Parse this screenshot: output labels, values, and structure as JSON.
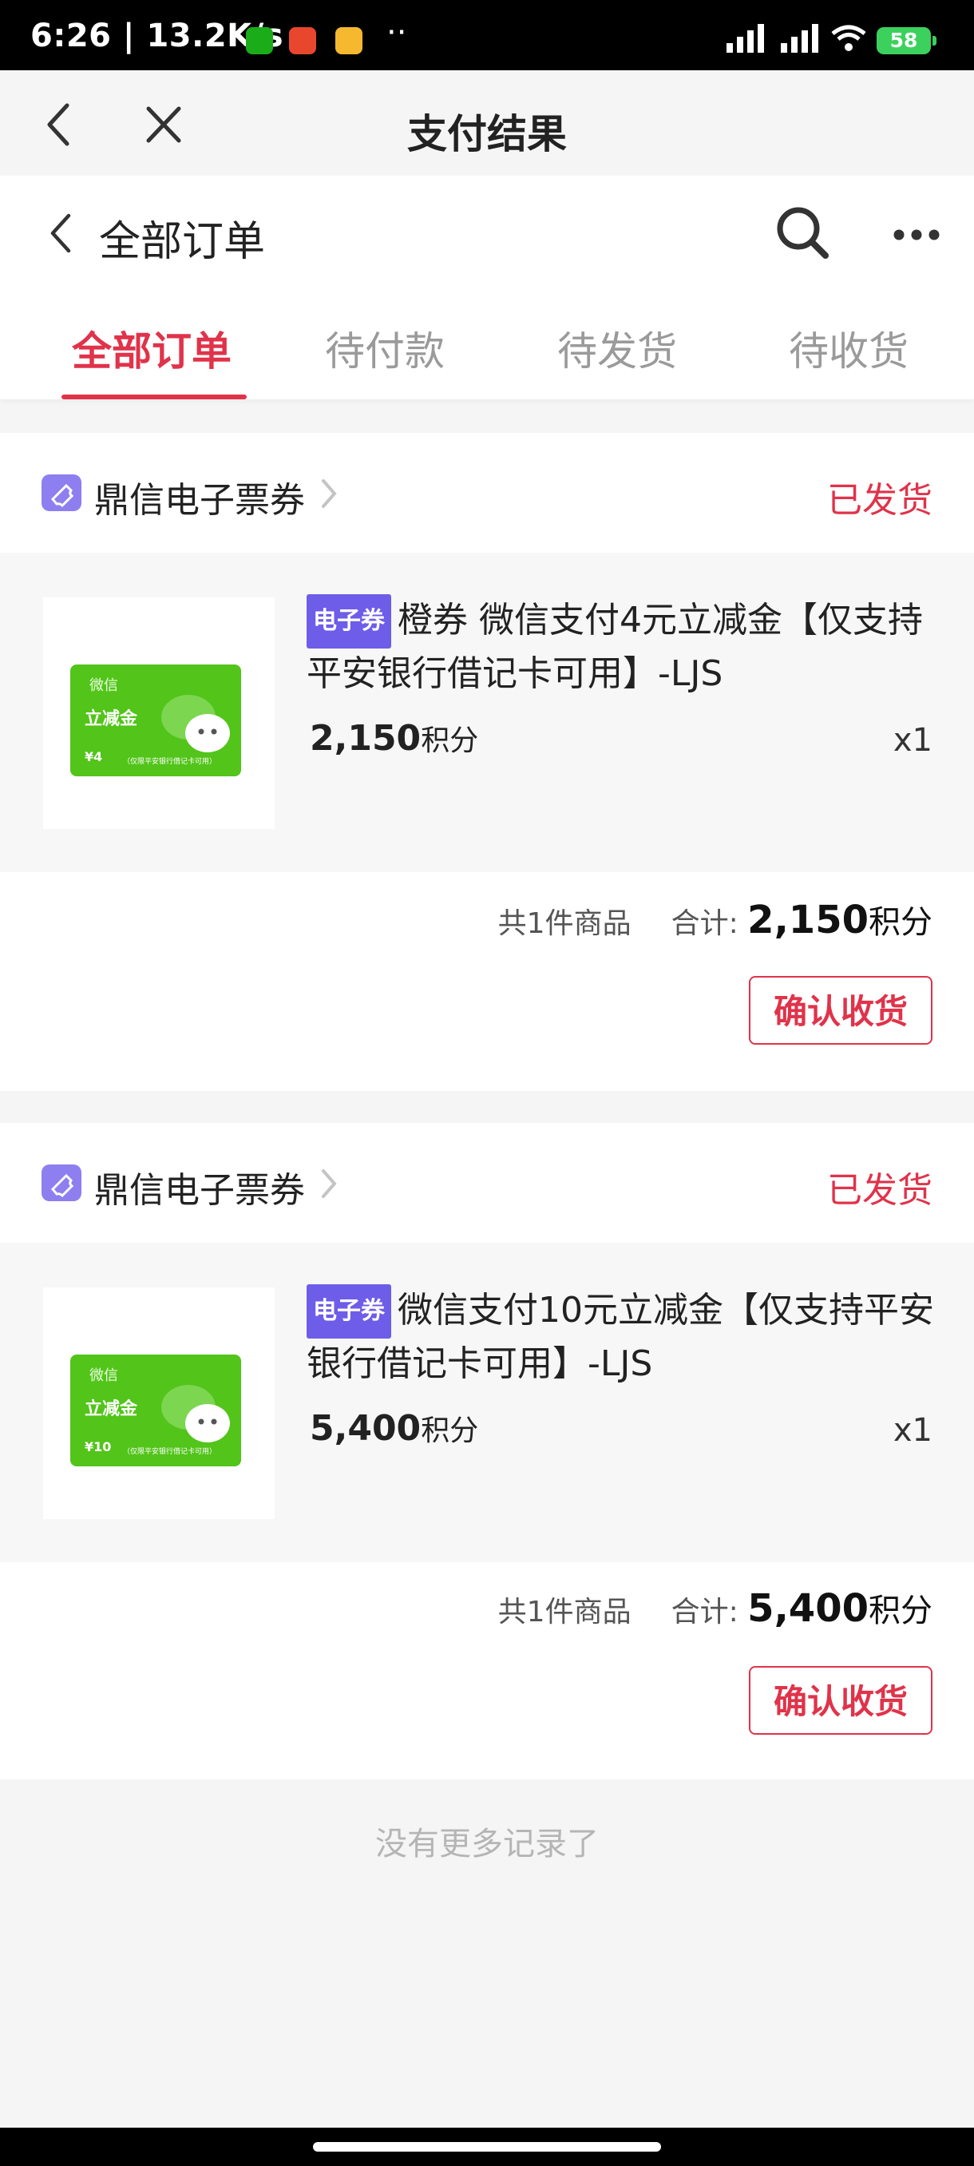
{
  "status_bar": {
    "time": "6:26 | 13.2K/s",
    "battery": "58"
  },
  "nav": {
    "title": "支付结果"
  },
  "orders_header": {
    "title": "全部订单"
  },
  "tabs": [
    {
      "label": "全部订单",
      "active": true
    },
    {
      "label": "待付款",
      "active": false
    },
    {
      "label": "待发货",
      "active": false
    },
    {
      "label": "待收货",
      "active": false
    }
  ],
  "orders": [
    {
      "shop": "鼎信电子票券",
      "status": "已发货",
      "tag": "电子券",
      "title": "橙券 微信支付4元立减金【仅支持平安银行借记卡可用】-LJS",
      "price": "2,150",
      "unit": "积分",
      "qty": "x1",
      "count_label": "共1件商品",
      "total_label": "合计:",
      "total": "2,150",
      "button": "确认收货",
      "voucher": {
        "brand": "微信",
        "label": "立减金",
        "amount": "¥4",
        "note": "（仅限平安银行借记卡可用）"
      }
    },
    {
      "shop": "鼎信电子票券",
      "status": "已发货",
      "tag": "电子券",
      "title": "微信支付10元立减金【仅支持平安银行借记卡可用】-LJS",
      "price": "5,400",
      "unit": "积分",
      "qty": "x1",
      "count_label": "共1件商品",
      "total_label": "合计:",
      "total": "5,400",
      "button": "确认收货",
      "voucher": {
        "brand": "微信",
        "label": "立减金",
        "amount": "¥10",
        "note": "（仅限平安银行借记卡可用）"
      }
    }
  ],
  "footer": {
    "no_more": "没有更多记录了"
  },
  "colors": {
    "accent": "#e0334a",
    "tag": "#6d5de8",
    "voucher_green": "#52c41a"
  }
}
